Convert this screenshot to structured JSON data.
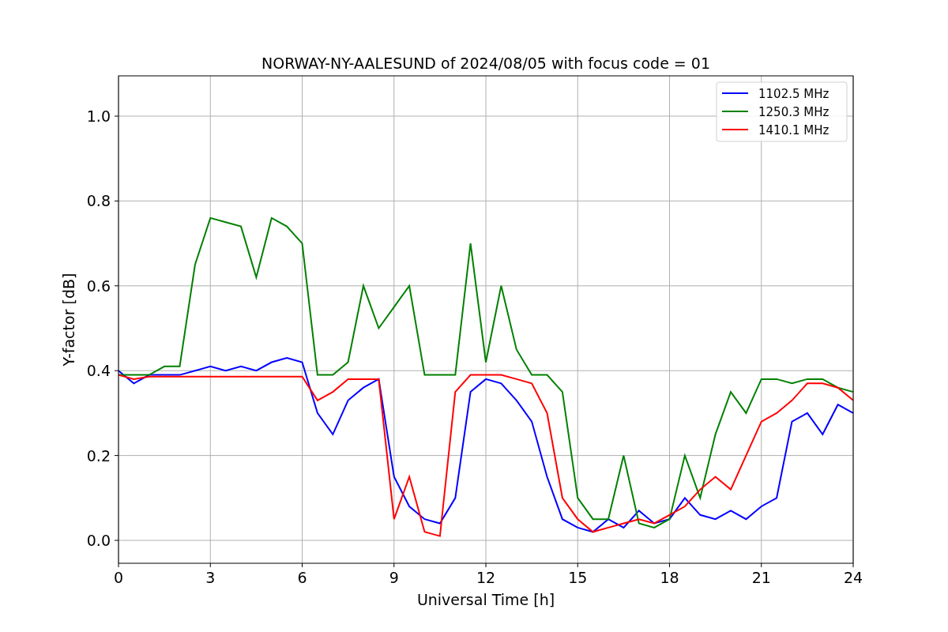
{
  "chart_data": {
    "type": "line",
    "title": "NORWAY-NY-AALESUND of 2024/08/05 with focus code = 01",
    "xlabel": "Universal Time [h]",
    "ylabel": "Y-factor [dB]",
    "x": [
      0,
      0.5,
      1,
      1.5,
      2,
      2.5,
      3,
      3.5,
      4,
      4.5,
      5,
      5.5,
      6,
      6.5,
      7,
      7.5,
      8,
      8.5,
      9,
      9.5,
      10,
      10.5,
      11,
      11.5,
      12,
      12.5,
      13,
      13.5,
      14,
      14.5,
      15,
      15.5,
      16,
      16.5,
      17,
      17.5,
      18,
      18.5,
      19,
      19.5,
      20,
      20.5,
      21,
      21.5,
      22,
      22.5,
      23,
      23.5,
      24
    ],
    "series": [
      {
        "name": "1102.5 MHz",
        "color": "#0000ff",
        "values": [
          0.4,
          0.37,
          0.39,
          0.39,
          0.39,
          0.4,
          0.41,
          0.4,
          0.41,
          0.4,
          0.42,
          0.43,
          0.42,
          0.3,
          0.25,
          0.33,
          0.36,
          0.38,
          0.15,
          0.08,
          0.05,
          0.04,
          0.1,
          0.35,
          0.38,
          0.37,
          0.33,
          0.28,
          0.15,
          0.05,
          0.03,
          0.02,
          0.05,
          0.03,
          0.07,
          0.04,
          0.05,
          0.1,
          0.06,
          0.05,
          0.07,
          0.05,
          0.08,
          0.1,
          0.28,
          0.3,
          0.25,
          0.32,
          0.3
        ]
      },
      {
        "name": "1250.3 MHz",
        "color": "#008000",
        "values": [
          0.39,
          0.39,
          0.39,
          0.41,
          0.41,
          0.65,
          0.76,
          0.75,
          0.74,
          0.62,
          0.76,
          0.74,
          0.7,
          0.39,
          0.39,
          0.42,
          0.6,
          0.5,
          0.55,
          0.6,
          0.39,
          0.39,
          0.39,
          0.7,
          0.42,
          0.6,
          0.45,
          0.39,
          0.39,
          0.35,
          0.1,
          0.05,
          0.05,
          0.2,
          0.04,
          0.03,
          0.05,
          0.2,
          0.1,
          0.25,
          0.35,
          0.3,
          0.38,
          0.38,
          0.37,
          0.38,
          0.38,
          0.36,
          0.35
        ]
      },
      {
        "name": "1410.1 MHz",
        "color": "#ff0000",
        "values": [
          0.39,
          0.38,
          0.386,
          0.386,
          0.386,
          0.386,
          0.386,
          0.386,
          0.386,
          0.386,
          0.386,
          0.386,
          0.386,
          0.33,
          0.35,
          0.38,
          0.38,
          0.38,
          0.05,
          0.15,
          0.02,
          0.01,
          0.35,
          0.39,
          0.39,
          0.39,
          0.38,
          0.37,
          0.3,
          0.1,
          0.05,
          0.02,
          0.03,
          0.04,
          0.05,
          0.04,
          0.06,
          0.08,
          0.12,
          0.15,
          0.12,
          0.2,
          0.28,
          0.3,
          0.33,
          0.37,
          0.37,
          0.36,
          0.33
        ]
      }
    ],
    "grid": true,
    "legend": true,
    "xlim": [
      0,
      24
    ],
    "ylim": [
      -0.054,
      1.095
    ],
    "xticks": [
      0,
      3,
      6,
      9,
      12,
      15,
      18,
      21,
      24
    ],
    "yticks": [
      {
        "value": 0,
        "label": "0.0"
      },
      {
        "value": 0.2,
        "label": "0.2"
      },
      {
        "value": 0.4,
        "label": "0.4"
      },
      {
        "value": 0.6,
        "label": "0.6"
      },
      {
        "value": 0.8,
        "label": "0.8"
      },
      {
        "value": 1,
        "label": "1.0"
      }
    ]
  }
}
